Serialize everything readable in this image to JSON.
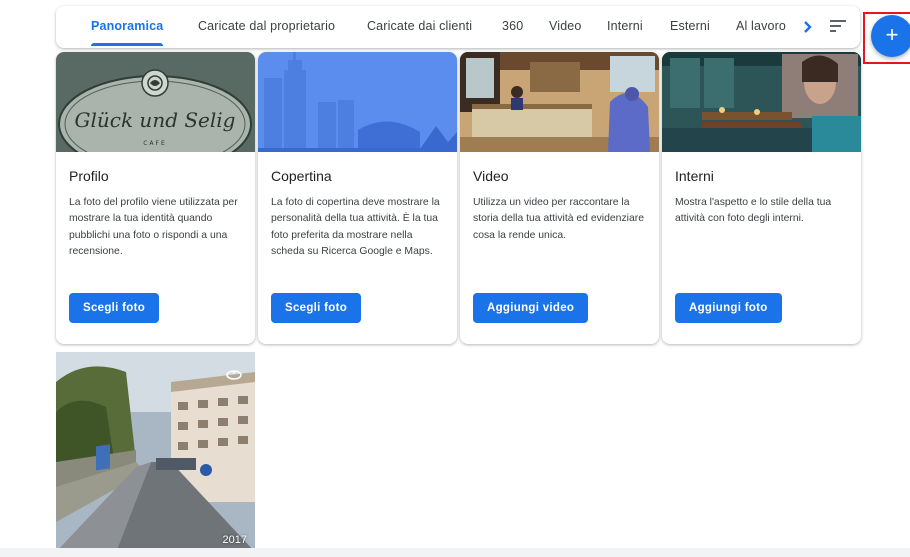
{
  "tabs": [
    {
      "label": "Panoramica",
      "active": true
    },
    {
      "label": "Caricate dal proprietario"
    },
    {
      "label": "Caricate dai clienti"
    },
    {
      "label": "360"
    },
    {
      "label": "Video"
    },
    {
      "label": "Interni"
    },
    {
      "label": "Esterni"
    },
    {
      "label": "Al lavoro"
    }
  ],
  "tabbar": {
    "next_icon": "chevron-right-icon",
    "sort_icon": "sort-icon"
  },
  "fab": {
    "label": "+",
    "icon": "add-icon"
  },
  "cards": [
    {
      "title": "Profilo",
      "description": "La foto del profilo viene utilizzata per mostrare la tua identità quando pubblichi una foto o rispondi a una recensione.",
      "button": "Scegli foto",
      "logo_text": "Glück und Selig",
      "logo_sub": "CAFE"
    },
    {
      "title": "Copertina",
      "description": "La foto di copertina deve mostrare la personalità della tua attività. È la tua foto preferita da mostrare nella scheda su Ricerca Google e Maps.",
      "button": "Scegli foto"
    },
    {
      "title": "Video",
      "description": "Utilizza un video per raccontare la storia della tua attività ed evidenziare cosa la rende unica.",
      "button": "Aggiungi video"
    },
    {
      "title": "Interni",
      "description": "Mostra l'aspetto e lo stile della tua attività con foto degli interni.",
      "button": "Aggiungi foto"
    }
  ],
  "photo": {
    "year": "2017",
    "badge_icon": "panorama-360-icon"
  },
  "colors": {
    "accent": "#1a73e8",
    "highlight_outline": "#e8151d"
  }
}
